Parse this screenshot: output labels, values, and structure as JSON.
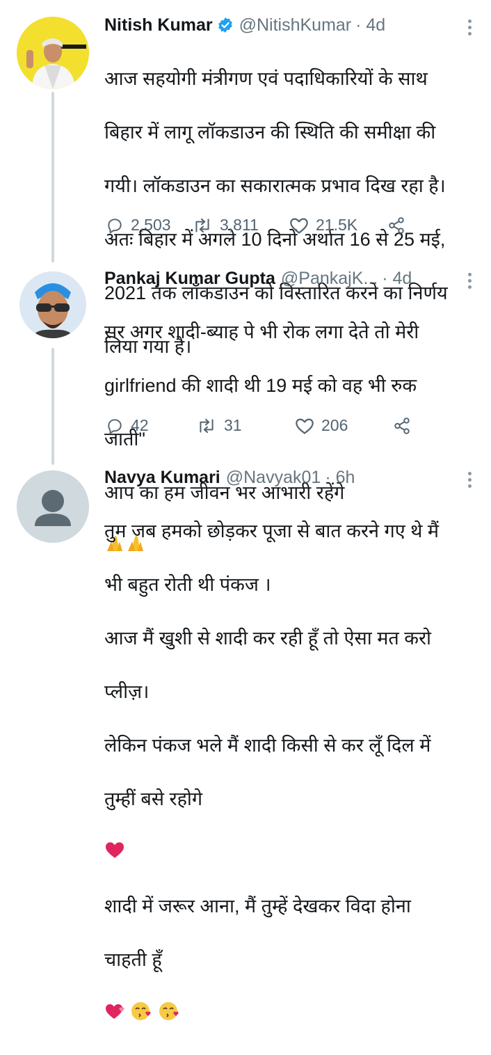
{
  "tweets": [
    {
      "name": "Nitish Kumar",
      "handle": "@NitishKumar",
      "time": "· 4d",
      "verified": true,
      "lines": [
        "आज सहयोगी मंत्रीगण एवं पदाधिकारियों के साथ",
        "बिहार में लागू लॉकडाउन की स्थिति की समीक्षा की",
        "गयी। लॉकडाउन का सकारात्मक प्रभाव दिख रहा है।",
        "अतः बिहार में अगले 10 दिनों अर्थात 16 से 25 मई,",
        "2021 तक लॉकडाउन को विस्तारित करने का निर्णय",
        "लिया गया है।"
      ],
      "replies": "2,503",
      "retweets": "3,811",
      "likes": "21.5K"
    },
    {
      "name": "Pankaj Kumar Gupta",
      "handle": "@PankajK...",
      "time": "· 4d",
      "lines": [
        "सर अगर शादी-ब्याह पे भी रोक लगा देते तो मेरी",
        "girlfriend की शादी थी 19 मई को वह भी रुक",
        "जाती\"",
        "आप का हम जीवन भर आभारी रहेंगे"
      ],
      "replies": "42",
      "retweets": "31",
      "likes": "206"
    },
    {
      "name": "Navya Kumari",
      "handle": "@Navyak01",
      "time": "· 6h",
      "lines": [
        "तुम जब हमको छोड़कर पूजा से बात करने गए थे मैं",
        "भी बहुत रोती थी पंकज ।",
        "आज मैं खुशी से शादी कर रही हूँ तो ऐसा मत करो",
        "प्लीज़।",
        "लेकिन पंकज भले मैं शादी किसी से कर लूँ दिल में",
        "तुम्हीं बसे रहोगे",
        "शादी में जरूर आना, मैं तुम्हें देखकर विदा होना",
        "चाहती हूँ"
      ]
    }
  ],
  "icons": {
    "reply": "reply-icon",
    "retweet": "retweet-icon",
    "like": "heart-icon",
    "share": "share-icon",
    "more": "more-icon",
    "verified": "verified-badge-icon"
  },
  "colors": {
    "verified": "#1da1f2",
    "heart_emoji": "#e0245e",
    "thread_line": "#cfd9de",
    "muted": "#66757f"
  }
}
